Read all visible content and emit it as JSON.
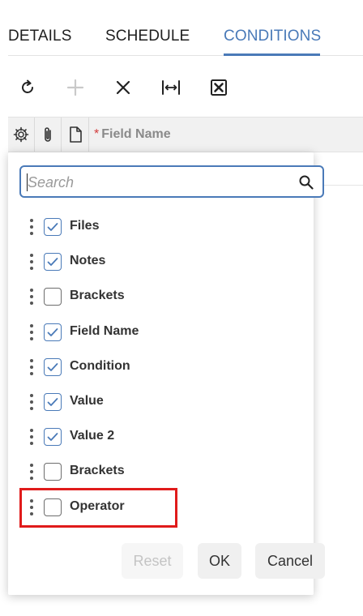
{
  "tabs": [
    {
      "label": "DETAILS",
      "active": false
    },
    {
      "label": "SCHEDULE",
      "active": false
    },
    {
      "label": "CONDITIONS",
      "active": true
    }
  ],
  "toolbar": {
    "buttons": [
      {
        "icon": "refresh-icon",
        "enabled": true
      },
      {
        "icon": "plus-icon",
        "enabled": false
      },
      {
        "icon": "close-icon",
        "enabled": true
      },
      {
        "icon": "fit-width-icon",
        "enabled": true
      },
      {
        "icon": "excel-export-icon",
        "enabled": true
      }
    ]
  },
  "grid": {
    "header": {
      "icons": [
        "gear-icon",
        "paperclip-icon",
        "document-icon"
      ],
      "required_mark": "*",
      "field_name": "Field Name"
    }
  },
  "column_chooser": {
    "search": {
      "value": "",
      "placeholder": "Search"
    },
    "items": [
      {
        "label": "Files",
        "checked": true
      },
      {
        "label": "Notes",
        "checked": true
      },
      {
        "label": "Brackets",
        "checked": false
      },
      {
        "label": "Field Name",
        "checked": true
      },
      {
        "label": "Condition",
        "checked": true
      },
      {
        "label": "Value",
        "checked": true
      },
      {
        "label": "Value 2",
        "checked": true
      },
      {
        "label": "Brackets",
        "checked": false
      },
      {
        "label": "Operator",
        "checked": false
      }
    ],
    "buttons": {
      "reset": "Reset",
      "ok": "OK",
      "cancel": "Cancel"
    }
  },
  "colors": {
    "accent": "#4a7ab8",
    "highlight": "#e01b1b",
    "required": "#d23b3b"
  }
}
